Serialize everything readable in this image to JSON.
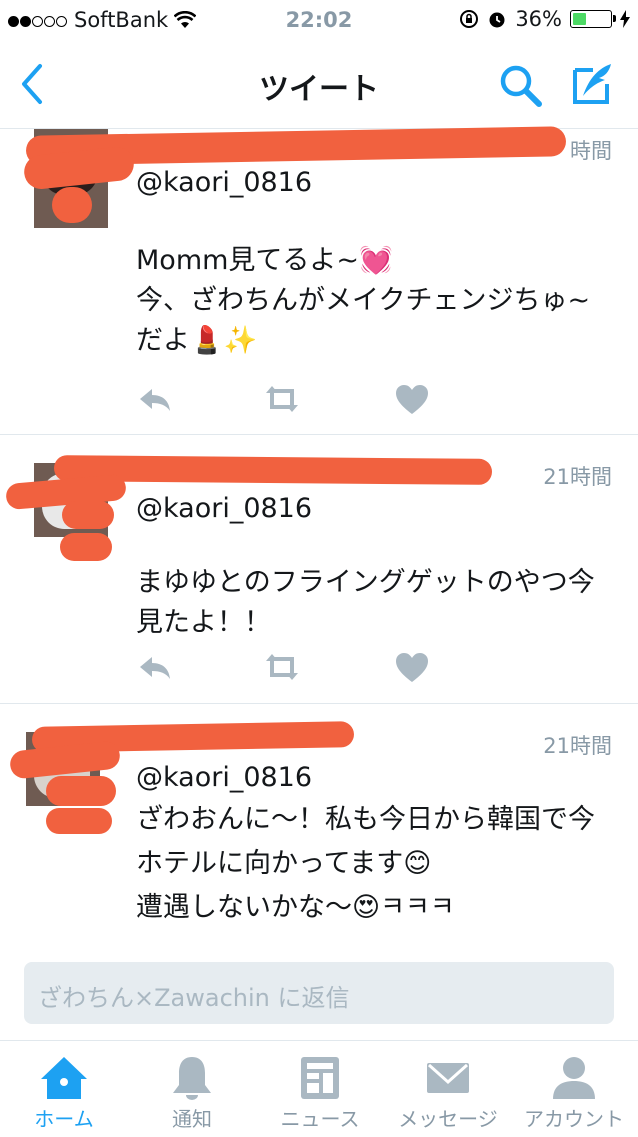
{
  "status_bar": {
    "carrier": "SoftBank",
    "time": "22:02",
    "battery_percent": "36%",
    "battery_level": 0.36,
    "signal_bars": 2
  },
  "nav": {
    "title": "ツイート"
  },
  "tweets": [
    {
      "time": "時間",
      "reply_to": "@kaori_0816",
      "text": "Momm見てるよ~💓\n今、ざわちんがメイクチェンジちゅ~\nだよ💄✨"
    },
    {
      "time": "21時間",
      "reply_to": "@kaori_0816",
      "text": "まゆゆとのフライングゲットのやつ今\n見たよ！！"
    },
    {
      "time": "21時間",
      "reply_to": "@kaori_0816",
      "text": "ざわおんに〜！私も今日から韓国で今\nホテルに向かってます😊\n遭遇しないかな〜😍ㅋㅋㅋ"
    }
  ],
  "reply": {
    "placeholder": "ざわちん×Zawachin に返信"
  },
  "tabs": [
    {
      "label": "ホーム",
      "icon": "home-icon",
      "active": true
    },
    {
      "label": "通知",
      "icon": "bell-icon",
      "active": false
    },
    {
      "label": "ニュース",
      "icon": "news-icon",
      "active": false
    },
    {
      "label": "メッセージ",
      "icon": "envelope-icon",
      "active": false
    },
    {
      "label": "アカウント",
      "icon": "person-icon",
      "active": false
    }
  ],
  "colors": {
    "accent": "#1da1f2",
    "inactive": "#8899a6",
    "redaction": "#f1613f"
  }
}
